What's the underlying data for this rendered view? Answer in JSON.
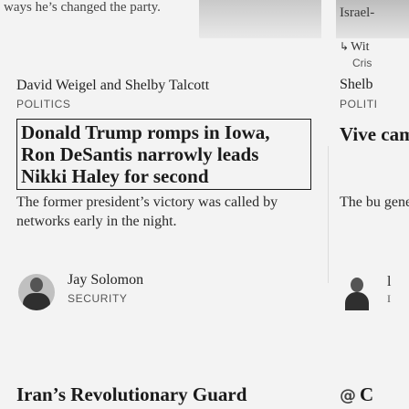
{
  "left": {
    "top_snippet": "ways he’s changed the party.",
    "article": {
      "byline": "David Weigel and Shelby Talcott",
      "section": "POLITICS",
      "headline": "Donald Trump romps in Iowa, Ron DeSantis narrowly leads Nikki Haley for second",
      "dek": "The former president’s victory was called by networks early in the night."
    },
    "author": {
      "name": "Jay Solomon",
      "section": "SECURITY"
    },
    "next_headline": "Iran’s Revolutionary Guard"
  },
  "right": {
    "top_snippet": "Israel-",
    "reply_label": "Wit",
    "reply_sub": "Cris",
    "byline": "Shelb",
    "section": "POLITI",
    "headline": "Vive camp Iowa",
    "dek": "The bu genera but sec",
    "author_a": "l",
    "author_b": "I",
    "next_headline": "C"
  },
  "icons": {
    "reply": "reply-arrow-icon",
    "next": "at-icon"
  }
}
